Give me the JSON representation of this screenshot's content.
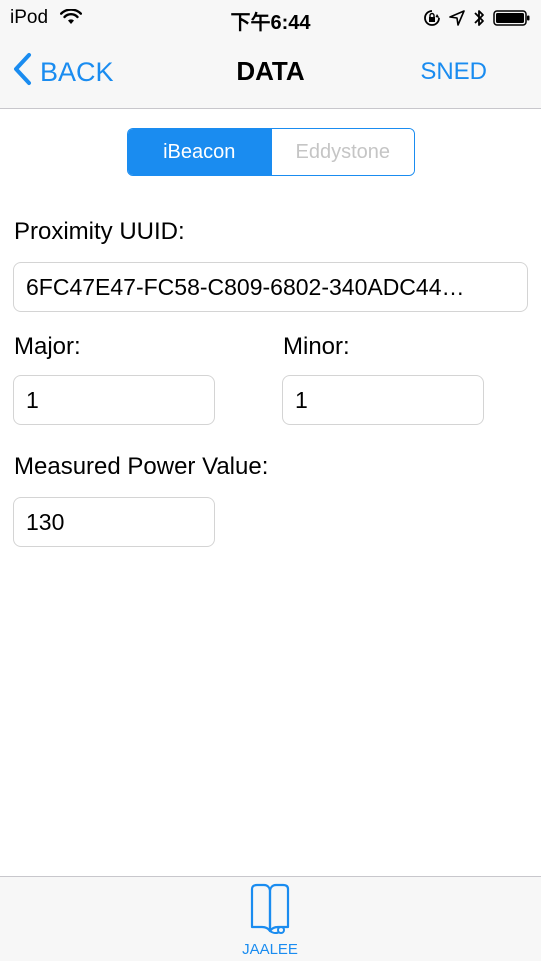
{
  "status_bar": {
    "carrier": "iPod",
    "time": "下午6:44"
  },
  "nav": {
    "back_label": "BACK",
    "title": "DATA",
    "send_label": "SNED"
  },
  "segments": {
    "ibeacon": "iBeacon",
    "eddystone": "Eddystone"
  },
  "form": {
    "uuid_label": "Proximity UUID:",
    "uuid_value": "6FC47E47-FC58-C809-6802-340ADC44…",
    "major_label": "Major:",
    "major_value": "1",
    "minor_label": "Minor:",
    "minor_value": "1",
    "power_label": "Measured Power Value:",
    "power_value": "130"
  },
  "tabbar": {
    "tab_label": "JAALEE"
  },
  "colors": {
    "accent": "#1a8cf0",
    "inactive_segment_text": "#c5c5c5",
    "bar_background": "#f7f7f7"
  }
}
